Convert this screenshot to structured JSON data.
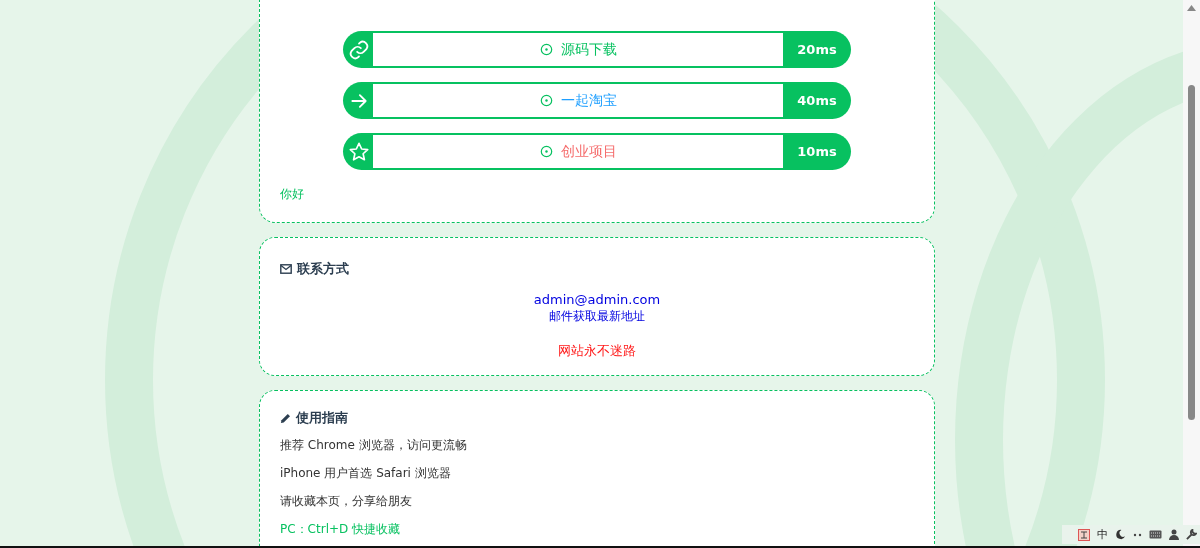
{
  "links": [
    {
      "kind": "link",
      "label": "源码下载",
      "color": "#07c160",
      "latency": "20ms"
    },
    {
      "kind": "arrow",
      "label": "一起淘宝",
      "color": "#1e9fff",
      "latency": "40ms"
    },
    {
      "kind": "star",
      "label": "创业项目",
      "color": "#f56c6c",
      "latency": "10ms"
    }
  ],
  "greeting": "你好",
  "contact": {
    "title": "联系方式",
    "email": "admin@admin.com",
    "note": "邮件获取最新地址",
    "slogan": "网站永不迷路"
  },
  "guide": {
    "title": "使用指南",
    "lines": [
      {
        "text": "推荐 Chrome 浏览器，访问更流畅",
        "highlight": false
      },
      {
        "text": "iPhone 用户首选 Safari 浏览器",
        "highlight": false
      },
      {
        "text": "请收藏本页，分享给朋友",
        "highlight": false
      },
      {
        "text": "PC：Ctrl+D 快捷收藏",
        "highlight": true
      }
    ]
  },
  "ime": {
    "mode": "中"
  }
}
